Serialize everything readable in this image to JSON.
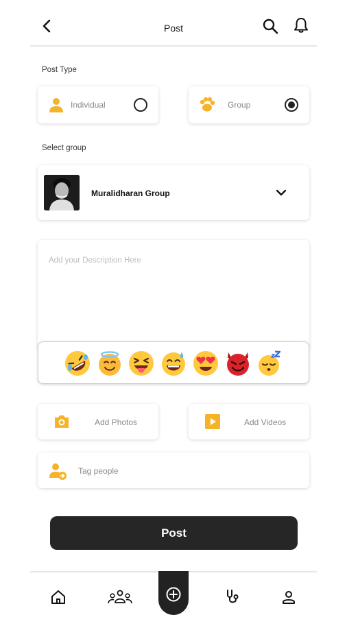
{
  "header": {
    "title": "Post"
  },
  "post_type": {
    "label": "Post Type",
    "options": [
      {
        "label": "Individual",
        "selected": false
      },
      {
        "label": "Group",
        "selected": true
      }
    ]
  },
  "select_group": {
    "label": "Select group",
    "selected_name": "Muralidharan Group"
  },
  "description": {
    "placeholder": "Add your Description Here"
  },
  "emojis": [
    "rolling-on-floor-laughing",
    "smiling-face-with-halo",
    "face-with-tongue",
    "grinning-face-with-sweat",
    "heart-eyes",
    "smiling-face-with-horns",
    "sleeping-face"
  ],
  "media": {
    "photos_label": "Add Photos",
    "videos_label": "Add Videos"
  },
  "tag": {
    "label": "Tag people"
  },
  "submit": {
    "label": "Post"
  },
  "nav": [
    "home",
    "groups",
    "create-post",
    "health",
    "profile"
  ],
  "colors": {
    "accent": "#F5B32A",
    "dark": "#262626"
  }
}
